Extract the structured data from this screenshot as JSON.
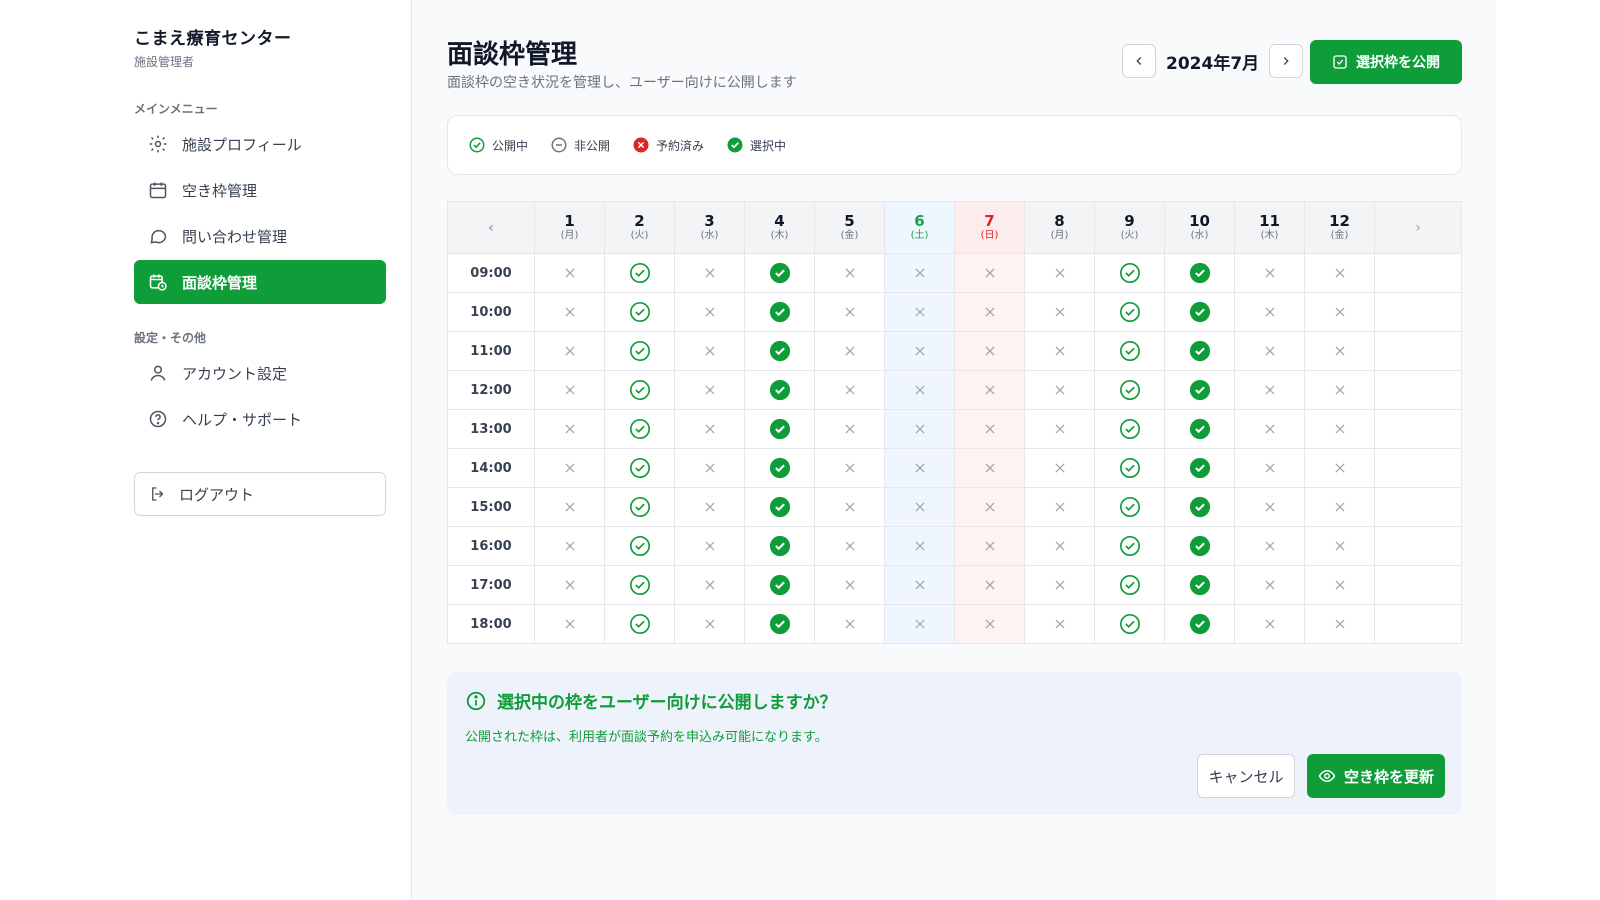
{
  "sidebar": {
    "brand_name": "こまえ療育センター",
    "brand_role": "施設管理者",
    "main_menu_label": "メインメニュー",
    "items": [
      {
        "label": "施設プロフィール",
        "icon": "gear-icon"
      },
      {
        "label": "空き枠管理",
        "icon": "calendar-icon"
      },
      {
        "label": "問い合わせ管理",
        "icon": "chat-bubble-icon"
      },
      {
        "label": "面談枠管理",
        "icon": "calendar-clock-icon",
        "active": true
      }
    ],
    "settings_label": "設定・その他",
    "settings_items": [
      {
        "label": "アカウント設定",
        "icon": "user-icon"
      },
      {
        "label": "ヘルプ・サポート",
        "icon": "help-circle-icon"
      }
    ],
    "logout_label": "ログアウト"
  },
  "header": {
    "title": "面談枠管理",
    "subtitle": "面談枠の空き状況を管理し、ユーザー向けに公開します",
    "month": "2024年7月",
    "publish_label": "選択枠を公開"
  },
  "legend": [
    {
      "label": "公開中",
      "icon": "check-circle-outline-icon"
    },
    {
      "label": "非公開",
      "icon": "minus-circle-icon"
    },
    {
      "label": "予約済み",
      "icon": "x-circle-filled-icon"
    },
    {
      "label": "選択中",
      "icon": "check-circle-filled-icon"
    }
  ],
  "grid": {
    "days": [
      {
        "day": "1",
        "dow": "(月)"
      },
      {
        "day": "2",
        "dow": "(火)"
      },
      {
        "day": "3",
        "dow": "(水)"
      },
      {
        "day": "4",
        "dow": "(木)"
      },
      {
        "day": "5",
        "dow": "(金)"
      },
      {
        "day": "6",
        "dow": "(土)",
        "type": "sat"
      },
      {
        "day": "7",
        "dow": "(日)",
        "type": "sun"
      },
      {
        "day": "8",
        "dow": "(月)"
      },
      {
        "day": "9",
        "dow": "(火)"
      },
      {
        "day": "10",
        "dow": "(水)"
      },
      {
        "day": "11",
        "dow": "(木)"
      },
      {
        "day": "12",
        "dow": "(金)"
      }
    ],
    "times": [
      "09:00",
      "10:00",
      "11:00",
      "12:00",
      "13:00",
      "14:00",
      "15:00",
      "16:00",
      "17:00",
      "18:00"
    ],
    "column_status": [
      "x",
      "open",
      "x",
      "selected",
      "x",
      "x",
      "x",
      "x",
      "open",
      "selected",
      "x",
      "x"
    ]
  },
  "confirm": {
    "title": "選択中の枠をユーザー向けに公開しますか？",
    "text": "公開された枠は、利用者が面談予約を申込み可能になります。",
    "cancel_label": "キャンセル",
    "update_label": "空き枠を更新"
  },
  "colors": {
    "accent": "#0f9d3a",
    "danger": "#dc2626",
    "saturday": "#16a34a",
    "sunday": "#dc2626"
  }
}
